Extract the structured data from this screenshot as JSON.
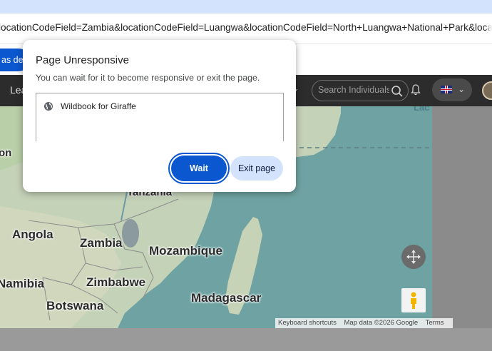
{
  "browser": {
    "url": "locationCodeField=Zambia&locationCodeField=Luangwa&locationCodeField=North+Luangwa+National+Park&locationCodeField=L"
  },
  "infobar": {
    "default_button_label": "as default"
  },
  "site_header": {
    "nav_learn": "Learn",
    "search_placeholder": "Search Individuals",
    "icons": [
      "search-icon",
      "bell-icon",
      "uk-flag-icon",
      "chevron-down-icon"
    ]
  },
  "map": {
    "labels": {
      "tanzania": "Tanzania",
      "angola": "Angola",
      "zambia": "Zambia",
      "mozambique": "Mozambique",
      "namibia": "Namibia",
      "zimbabwe": "Zimbabwe",
      "botswana": "Botswana",
      "madagascar": "Madagascar",
      "congo_partial": "on",
      "top_right_partial": "Lac"
    },
    "attribution": {
      "keyboard": "Keyboard shortcuts",
      "data": "Map data ©2026 Google",
      "terms": "Terms"
    }
  },
  "dialog": {
    "title": "Page Unresponsive",
    "message": "You can wait for it to become responsive or exit the page.",
    "pages": [
      {
        "label": "Wildbook for Giraffe",
        "icon": "globe-icon"
      }
    ],
    "wait_label": "Wait",
    "exit_label": "Exit page"
  },
  "colors": {
    "accent": "#0b57d0",
    "tonal": "#d3e3fd",
    "header_bg": "#2c2c2c",
    "map_water": "#6fa3a3"
  }
}
